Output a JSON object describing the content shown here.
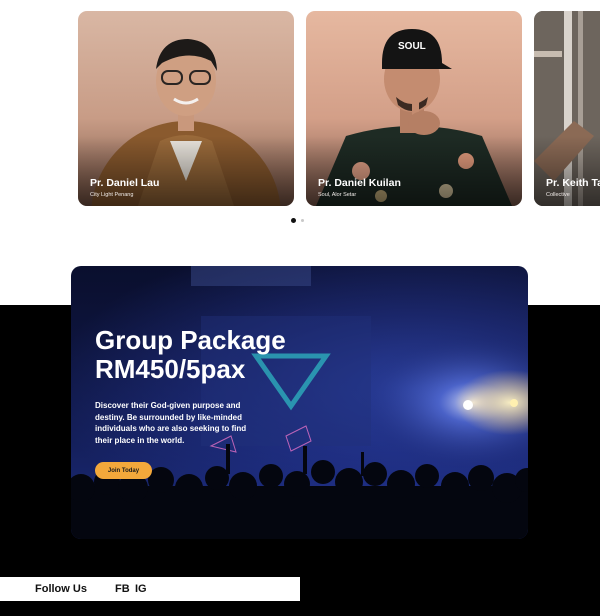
{
  "speakers": [
    {
      "name": "Pr. Daniel Lau",
      "church": "City Light Penang"
    },
    {
      "name": "Pr. Daniel Kuilan",
      "church": "Soul, Alor Setar"
    },
    {
      "name": "Pr. Keith Ta",
      "church": "Collective"
    }
  ],
  "carousel": {
    "active_index": 1,
    "dot_count": 2
  },
  "package": {
    "title": "Group Package",
    "price": "RM450/5pax",
    "description": "Discover their God-given purpose and destiny. Be surrounded by like-minded individuals who are also seeking to find their place in the world.",
    "cta_label": "Join Today"
  },
  "social": {
    "label": "Follow Us",
    "links": [
      "FB",
      "IG"
    ]
  },
  "colors": {
    "cta": "#f3a83b",
    "band": "#000000",
    "banner": "#1a2566"
  }
}
